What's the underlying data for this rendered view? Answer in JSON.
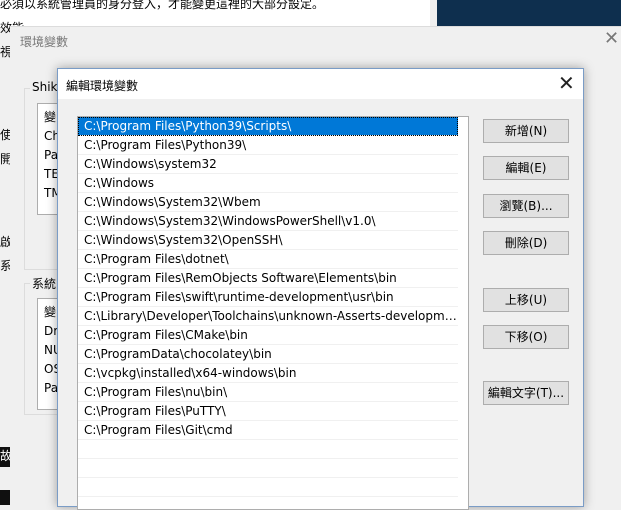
{
  "background": {
    "top_text": "必須以系統管理員的身分登入，才能變更這裡的大部分設定。",
    "left_fragments": [
      "效能",
      "視",
      "使用",
      "開",
      "啟動",
      "系統",
      "故障"
    ]
  },
  "env_dialog": {
    "title": "環境變數",
    "user_group_title": "Shiki",
    "user_list_frags": [
      "變",
      "Ch",
      "Pa",
      "TE",
      "TM"
    ],
    "system_group_title": "系統",
    "system_list_frags": [
      "變",
      "Dr",
      "NU",
      "OS",
      "Pa"
    ]
  },
  "edit_dialog": {
    "title": "編輯環境變數",
    "paths": [
      "C:\\Program Files\\Python39\\Scripts\\",
      "C:\\Program Files\\Python39\\",
      "C:\\Windows\\system32",
      "C:\\Windows",
      "C:\\Windows\\System32\\Wbem",
      "C:\\Windows\\System32\\WindowsPowerShell\\v1.0\\",
      "C:\\Windows\\System32\\OpenSSH\\",
      "C:\\Program Files\\dotnet\\",
      "C:\\Program Files\\RemObjects Software\\Elements\\bin",
      "C:\\Program Files\\swift\\runtime-development\\usr\\bin",
      "C:\\Library\\Developer\\Toolchains\\unknown-Asserts-development.xcto...",
      "C:\\Program Files\\CMake\\bin",
      "C:\\ProgramData\\chocolatey\\bin",
      "C:\\vcpkg\\installed\\x64-windows\\bin",
      "C:\\Program Files\\nu\\bin\\",
      "C:\\Program Files\\PuTTY\\",
      "C:\\Program Files\\Git\\cmd"
    ],
    "selected_index": 0,
    "buttons": {
      "new": "新增(N)",
      "edit": "編輯(E)",
      "browse": "瀏覽(B)...",
      "delete": "刪除(D)",
      "move_up": "上移(U)",
      "move_down": "下移(O)",
      "edit_text": "編輯文字(T)..."
    }
  }
}
